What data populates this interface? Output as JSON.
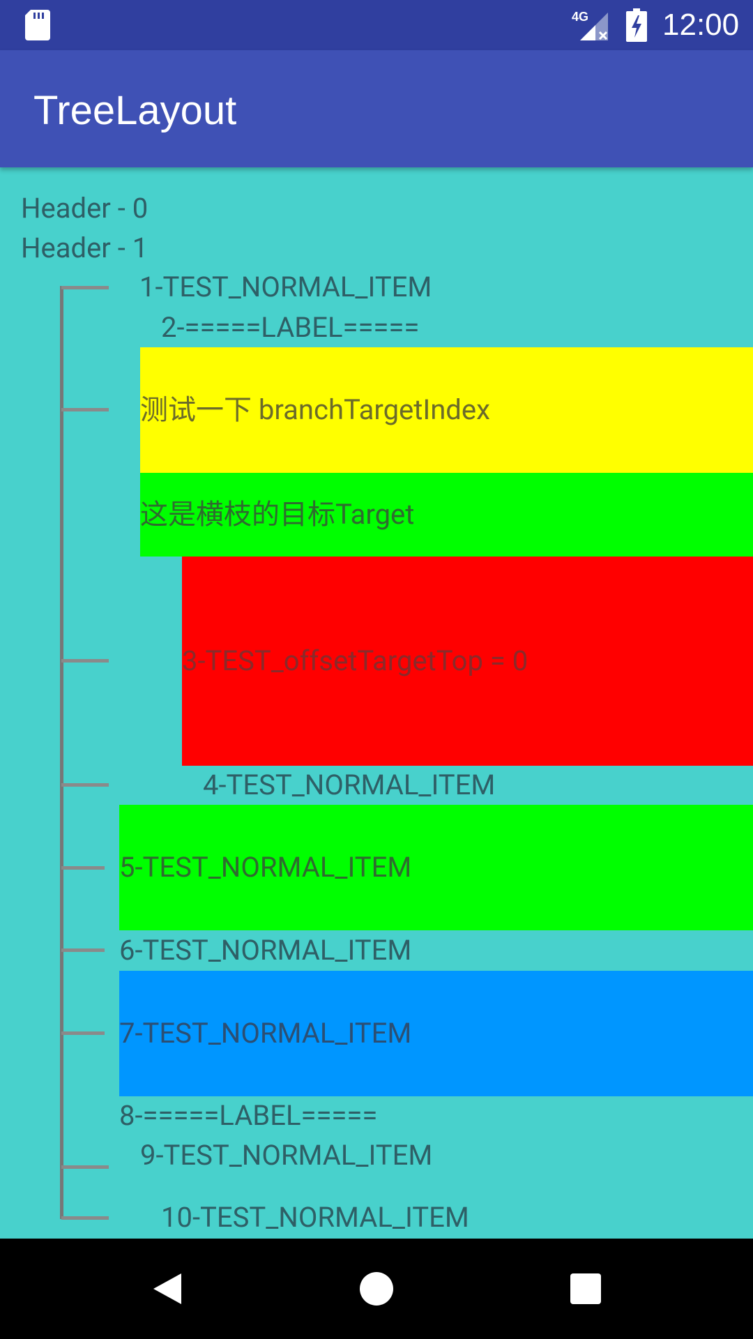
{
  "status_bar": {
    "network_label": "4G",
    "time": "12:00"
  },
  "app_bar": {
    "title": "TreeLayout"
  },
  "tree": {
    "header0": "Header - 0",
    "header1": "Header - 1",
    "item1": "1-TEST_NORMAL_ITEM",
    "item2_label": "2-=====LABEL=====",
    "branch_target_index": "测试一下 branchTargetIndex",
    "branch_target": "这是横枝的目标Target",
    "item3": "3-TEST_offsetTargetTop = 0",
    "item4": "4-TEST_NORMAL_ITEM",
    "item5": "5-TEST_NORMAL_ITEM",
    "item6": "6-TEST_NORMAL_ITEM",
    "item7": "7-TEST_NORMAL_ITEM",
    "item8_label": "8-=====LABEL=====",
    "item9": "9-TEST_NORMAL_ITEM",
    "item10": "10-TEST_NORMAL_ITEM"
  },
  "colors": {
    "status_bar": "#303F9F",
    "app_bar": "#3F51B5",
    "content_bg": "#48D1CC",
    "yellow_block": "#FFFF00",
    "green_block": "#00FF00",
    "red_block": "#FF0000",
    "blue_block": "#0096FF",
    "tree_line": "#808080"
  },
  "nav_bar": {
    "back_icon": "triangle-back-icon",
    "home_icon": "circle-home-icon",
    "recents_icon": "square-recents-icon"
  }
}
